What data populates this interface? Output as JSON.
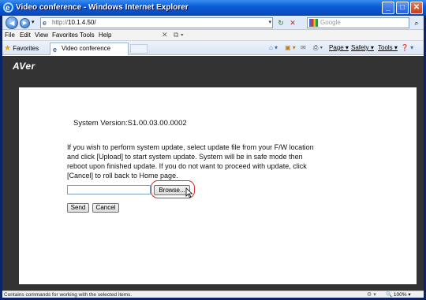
{
  "window": {
    "title": "Video conference - Windows Internet Explorer",
    "controls": [
      "minimize",
      "maximize",
      "close"
    ]
  },
  "addressbar": {
    "url_prefix": "http://",
    "url_host": "10.1.4.50/",
    "search_placeholder": "Google",
    "icons": [
      "back-icon",
      "forward-icon",
      "refresh-icon",
      "stop-icon",
      "search-icon"
    ]
  },
  "menubar": {
    "items": [
      "File",
      "Edit",
      "View",
      "Favorites",
      "Tools",
      "Help"
    ]
  },
  "favbar": {
    "favorites_label": "Favorites",
    "tab_title": "Video conference",
    "commands": [
      "Page",
      "Safety",
      "Tools"
    ]
  },
  "page": {
    "logo": "AVer",
    "version": "System Version:S1.00.03.00.0002",
    "message": "If you wish to perform system update, select update file from your F/W location and click [Upload] to start system update. System will be in safe mode then reboot upon finished update. If you do not want to proceed with update, click [Cancel] to roll back to Home page.",
    "file_value": "",
    "browse_label": "Browse...",
    "send_label": "Send",
    "cancel_label": "Cancel"
  },
  "statusbar": {
    "text": "Contains commands for working with the selected items.",
    "zoom": "100%"
  },
  "colors": {
    "titlebar": "#0a5ed8",
    "page_bg": "#333333",
    "highlight": "#d62b2b"
  }
}
